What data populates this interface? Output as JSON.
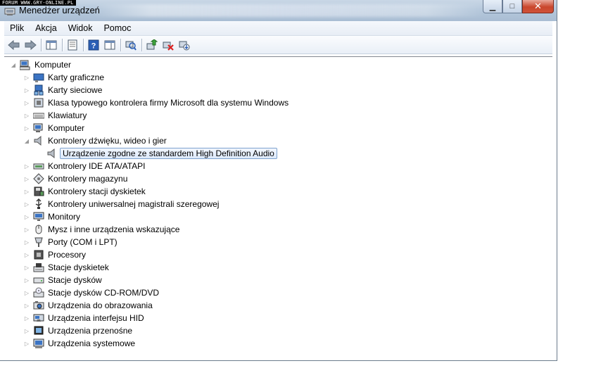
{
  "watermark": "FORUM WWW.GRY-ONLINE.PL",
  "window": {
    "title": "Menedżer urządzeń",
    "buttons": {
      "minimize": "▁",
      "maximize": "□",
      "close": "✕"
    }
  },
  "menu": [
    "Plik",
    "Akcja",
    "Widok",
    "Pomoc"
  ],
  "toolbar": {
    "icons": [
      "back-arrow-icon",
      "forward-arrow-icon",
      "show-hide-console-tree-icon",
      "properties-icon",
      "help-icon",
      "action-pane-icon",
      "scan-hardware-changes-icon",
      "update-driver-icon",
      "uninstall-icon",
      "disable-device-icon"
    ]
  },
  "tree": {
    "root": {
      "label": "Komputer",
      "expanded": true
    },
    "categories": [
      {
        "label": "Karty graficzne",
        "icon": "display-adapter-icon"
      },
      {
        "label": "Karty sieciowe",
        "icon": "network-adapter-icon"
      },
      {
        "label": "Klasa typowego kontrolera firmy Microsoft dla systemu Windows",
        "icon": "controller-class-icon"
      },
      {
        "label": "Klawiatury",
        "icon": "keyboard-icon"
      },
      {
        "label": "Komputer",
        "icon": "computer-icon"
      },
      {
        "label": "Kontrolery dźwięku, wideo i gier",
        "icon": "speaker-icon",
        "expanded": true,
        "children": [
          {
            "label": "Urządzenie zgodne ze standardem High Definition Audio",
            "icon": "speaker-icon",
            "selected": true
          }
        ]
      },
      {
        "label": "Kontrolery IDE ATA/ATAPI",
        "icon": "ide-controller-icon"
      },
      {
        "label": "Kontrolery magazynu",
        "icon": "storage-controller-icon"
      },
      {
        "label": "Kontrolery stacji dyskietek",
        "icon": "floppy-controller-icon"
      },
      {
        "label": "Kontrolery uniwersalnej magistrali szeregowej",
        "icon": "usb-icon"
      },
      {
        "label": "Monitory",
        "icon": "monitor-icon"
      },
      {
        "label": "Mysz i inne urządzenia wskazujące",
        "icon": "mouse-icon"
      },
      {
        "label": "Porty (COM i LPT)",
        "icon": "port-icon"
      },
      {
        "label": "Procesory",
        "icon": "processor-icon"
      },
      {
        "label": "Stacje dyskietek",
        "icon": "floppy-drive-icon"
      },
      {
        "label": "Stacje dysków",
        "icon": "disk-drive-icon"
      },
      {
        "label": "Stacje dysków CD-ROM/DVD",
        "icon": "cdrom-icon"
      },
      {
        "label": "Urządzenia do obrazowania",
        "icon": "imaging-device-icon"
      },
      {
        "label": "Urządzenia interfejsu HID",
        "icon": "hid-icon"
      },
      {
        "label": "Urządzenia przenośne",
        "icon": "portable-device-icon"
      },
      {
        "label": "Urządzenia systemowe",
        "icon": "system-device-icon"
      }
    ]
  }
}
